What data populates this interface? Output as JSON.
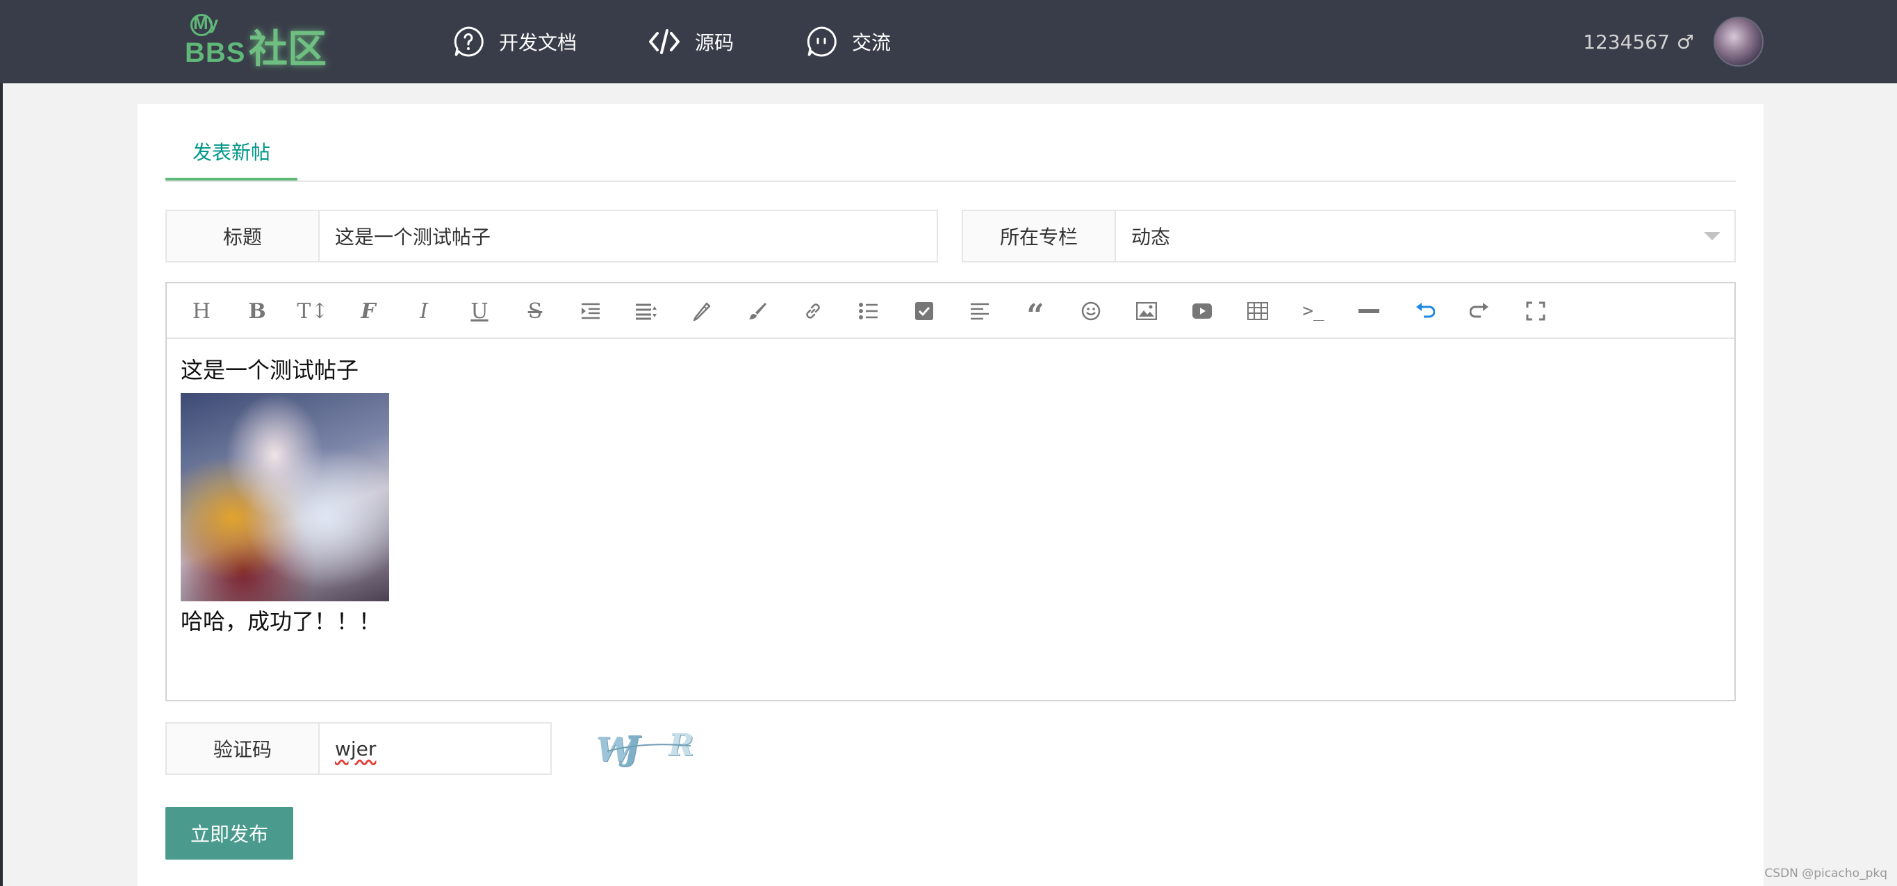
{
  "header": {
    "logo": {
      "small": "My",
      "brand": "BBS",
      "cn": "社区"
    },
    "nav": [
      {
        "label": "开发文档",
        "icon": "question-bubble-icon"
      },
      {
        "label": "源码",
        "icon": "code-icon"
      },
      {
        "label": "交流",
        "icon": "chat-face-icon"
      }
    ],
    "user": {
      "name": "1234567",
      "gender": "♂"
    }
  },
  "page": {
    "tab": "发表新帖",
    "title_field": {
      "label": "标题",
      "value": "这是一个测试帖子"
    },
    "column_field": {
      "label": "所在专栏",
      "value": "动态"
    },
    "editor": {
      "toolbar": [
        "heading-icon",
        "bold-icon",
        "font-size-icon",
        "font-family-icon",
        "italic-icon",
        "underline-icon",
        "strikethrough-icon",
        "indent-icon",
        "line-height-icon",
        "pen-color-icon",
        "brush-bg-color-icon",
        "link-icon",
        "bullet-list-icon",
        "checkbox-icon",
        "align-left-icon",
        "quote-icon",
        "emoji-icon",
        "image-icon",
        "video-icon",
        "table-icon",
        "code-block-icon",
        "divider-icon",
        "undo-icon",
        "redo-icon",
        "fullscreen-icon"
      ],
      "content_line1": "这是一个测试帖子",
      "content_line2": "哈哈，成功了！！！"
    },
    "captcha_field": {
      "label": "验证码",
      "value": "wjer",
      "image_text": [
        "W",
        "J",
        "R"
      ]
    },
    "submit_label": "立即发布"
  },
  "watermark": "CSDN @picacho_pkq",
  "colors": {
    "header_bg": "#393d49",
    "accent": "#5fb878",
    "tab_text": "#009688",
    "button_bg": "#4a9b8e",
    "undo_blue": "#1e88e5"
  }
}
